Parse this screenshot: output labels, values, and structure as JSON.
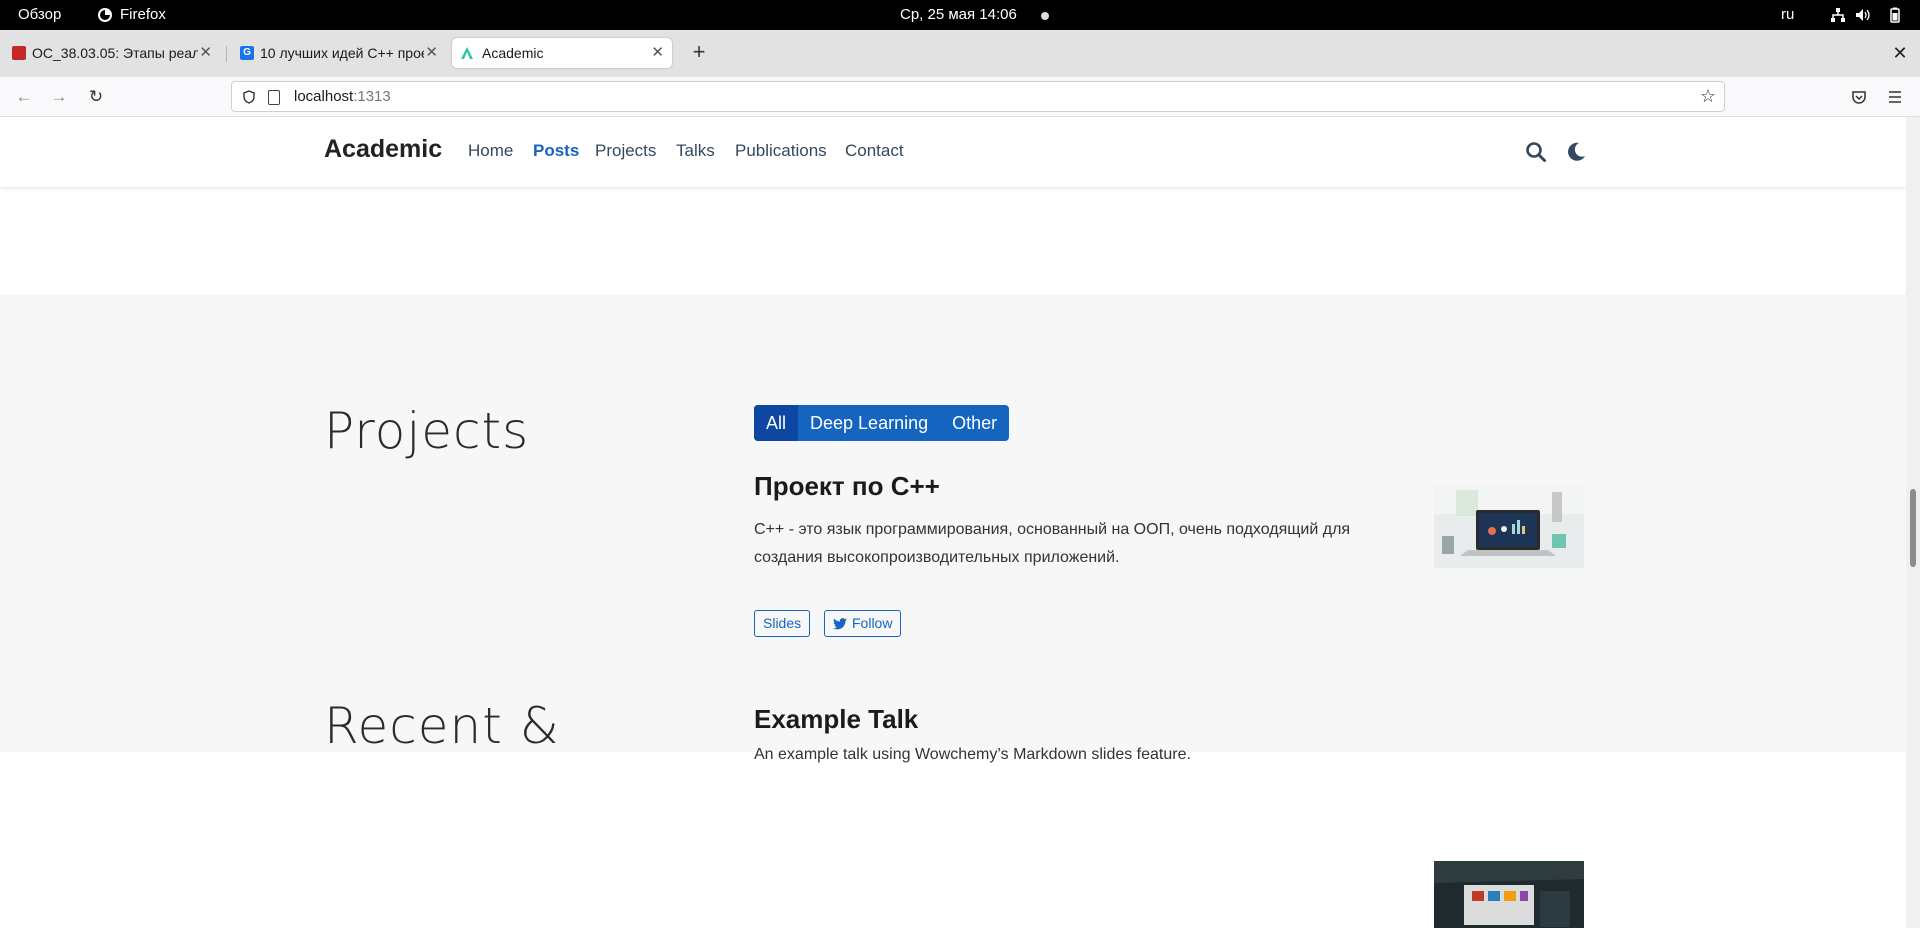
{
  "os_bar": {
    "overview": "Обзор",
    "app": "Firefox",
    "datetime": "Ср, 25 мая  14:06",
    "lang": "ru"
  },
  "browser": {
    "tabs": [
      {
        "title": "ОС_38.03.05: Этапы реал",
        "active": false
      },
      {
        "title": "10 лучших идей C++ прое",
        "active": false
      },
      {
        "title": "Academic",
        "active": true
      }
    ],
    "url_host": "localhost",
    "url_port": ":1313"
  },
  "site": {
    "brand": "Academic",
    "menu": [
      {
        "label": "Home",
        "active": false
      },
      {
        "label": "Posts",
        "active": true
      },
      {
        "label": "Projects",
        "active": false
      },
      {
        "label": "Talks",
        "active": false
      },
      {
        "label": "Publications",
        "active": false
      },
      {
        "label": "Contact",
        "active": false
      }
    ]
  },
  "projects": {
    "heading": "Projects",
    "filters": [
      {
        "label": "All",
        "selected": true
      },
      {
        "label": "Deep Learning",
        "selected": false
      },
      {
        "label": "Other",
        "selected": false
      }
    ],
    "item": {
      "title": "Проект по C++",
      "desc_line1": "C++ - это язык программирования, основанный на ООП, очень подходящий для",
      "desc_line2": "создания высокопроизводительных приложений.",
      "btn_slides": "Slides",
      "btn_follow": "Follow"
    }
  },
  "talks": {
    "heading": "Recent &",
    "item": {
      "title": "Example Talk",
      "desc": "An example talk using Wowchemy’s Markdown slides feature."
    }
  },
  "colors": {
    "accent": "#1565c0",
    "accent_dark": "#0d47a1",
    "section_bg": "#f7f7f7"
  }
}
